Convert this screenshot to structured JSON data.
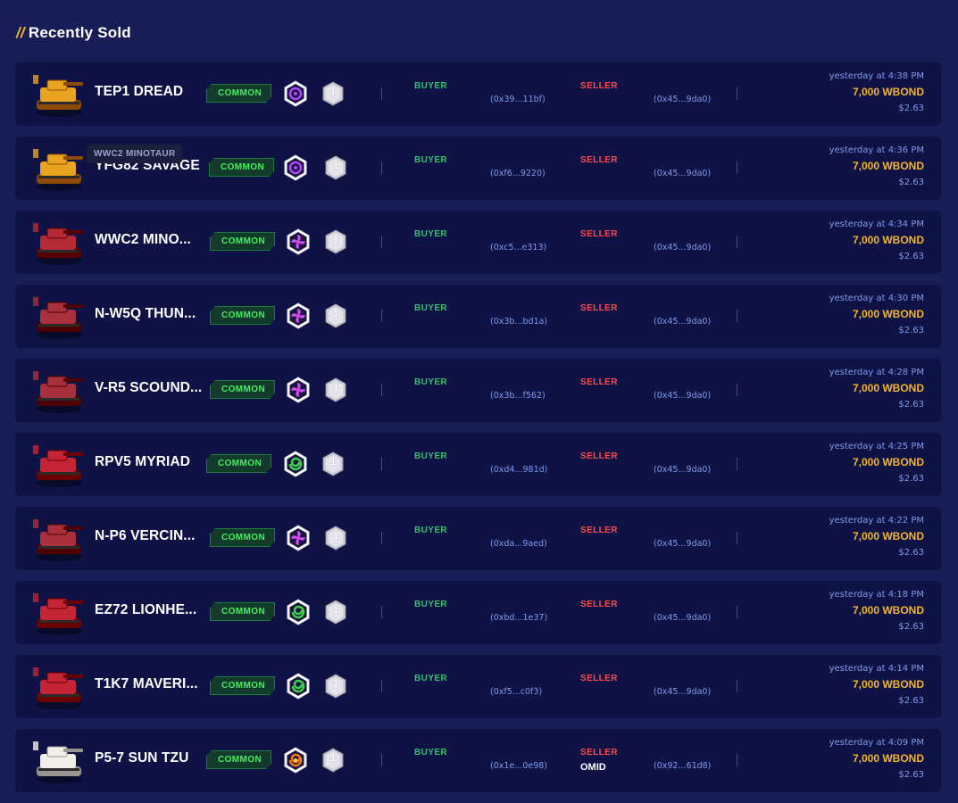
{
  "section": {
    "slashes": "//",
    "title": "Recently Sold"
  },
  "tooltip": "WWC2 MINOTAUR",
  "labels": {
    "buyer": "BUYER",
    "seller": "SELLER"
  },
  "rows": [
    {
      "name": "TEP1 DREAD",
      "rarity": "COMMON",
      "class_icon": "psi-ring-icon",
      "class_color": "#b047ff",
      "level": "1",
      "buyer": "(0x39...11bf)",
      "seller_name": "",
      "seller": "(0x45...9da0)",
      "time": "yesterday at 4:38 PM",
      "price": "7,000 WBOND",
      "usd": "$2.63",
      "tank_color": "#e8a420"
    },
    {
      "name": "YFG82 SAVAGE",
      "rarity": "COMMON",
      "class_icon": "psi-ring-icon",
      "class_color": "#b047ff",
      "level": "1",
      "buyer": "(0xf6...9220)",
      "seller_name": "",
      "seller": "(0x45...9da0)",
      "time": "yesterday at 4:36 PM",
      "price": "7,000 WBOND",
      "usd": "$2.63",
      "tank_color": "#e8a420"
    },
    {
      "name": "WWC2 MINO...",
      "rarity": "COMMON",
      "class_icon": "pinwheel-icon",
      "class_color": "#d24bf0",
      "level": "1",
      "buyer": "(0xc5...e313)",
      "seller_name": "",
      "seller": "(0x45...9da0)",
      "time": "yesterday at 4:34 PM",
      "price": "7,000 WBOND",
      "usd": "$2.63",
      "tank_color": "#b52a35"
    },
    {
      "name": "N-W5Q THUN...",
      "rarity": "COMMON",
      "class_icon": "pinwheel-icon",
      "class_color": "#d24bf0",
      "level": "1",
      "buyer": "(0x3b...bd1a)",
      "seller_name": "",
      "seller": "(0x45...9da0)",
      "time": "yesterday at 4:30 PM",
      "price": "7,000 WBOND",
      "usd": "$2.63",
      "tank_color": "#a8303c"
    },
    {
      "name": "V-R5 SCOUND...",
      "rarity": "COMMON",
      "class_icon": "pinwheel-icon",
      "class_color": "#d24bf0",
      "level": "1",
      "buyer": "(0x3b...f562)",
      "seller_name": "",
      "seller": "(0x45...9da0)",
      "time": "yesterday at 4:28 PM",
      "price": "7,000 WBOND",
      "usd": "$2.63",
      "tank_color": "#a8303c"
    },
    {
      "name": "RPV5 MYRIAD",
      "rarity": "COMMON",
      "class_icon": "swirl-icon",
      "class_color": "#3bd24a",
      "level": "1",
      "buyer": "(0xd4...981d)",
      "seller_name": "",
      "seller": "(0x45...9da0)",
      "time": "yesterday at 4:25 PM",
      "price": "7,000 WBOND",
      "usd": "$2.63",
      "tank_color": "#c42535"
    },
    {
      "name": "N-P6 VERCIN...",
      "rarity": "COMMON",
      "class_icon": "pinwheel-icon",
      "class_color": "#d24bf0",
      "level": "1",
      "buyer": "(0xda...9aed)",
      "seller_name": "",
      "seller": "(0x45...9da0)",
      "time": "yesterday at 4:22 PM",
      "price": "7,000 WBOND",
      "usd": "$2.63",
      "tank_color": "#a8303c"
    },
    {
      "name": "EZ72 LIONHE...",
      "rarity": "COMMON",
      "class_icon": "swirl-icon",
      "class_color": "#3bd24a",
      "level": "1",
      "buyer": "(0xbd...1e37)",
      "seller_name": "",
      "seller": "(0x45...9da0)",
      "time": "yesterday at 4:18 PM",
      "price": "7,000 WBOND",
      "usd": "$2.63",
      "tank_color": "#c42535"
    },
    {
      "name": "T1K7 MAVERI...",
      "rarity": "COMMON",
      "class_icon": "swirl-icon",
      "class_color": "#3bd24a",
      "level": "1",
      "buyer": "(0xf5...c0f3)",
      "seller_name": "",
      "seller": "(0x45...9da0)",
      "time": "yesterday at 4:14 PM",
      "price": "7,000 WBOND",
      "usd": "$2.63",
      "tank_color": "#c42535"
    },
    {
      "name": "P5-7 SUN TZU",
      "rarity": "COMMON",
      "class_icon": "flame-swirl-icon",
      "class_color": "#f07a1a",
      "level": "1",
      "buyer": "(0x1e...0e98)",
      "seller_name": "OMID",
      "seller": "(0x92...61d8)",
      "time": "yesterday at 4:09 PM",
      "price": "7,000 WBOND",
      "usd": "$2.63",
      "tank_color": "#f2efe8"
    }
  ]
}
